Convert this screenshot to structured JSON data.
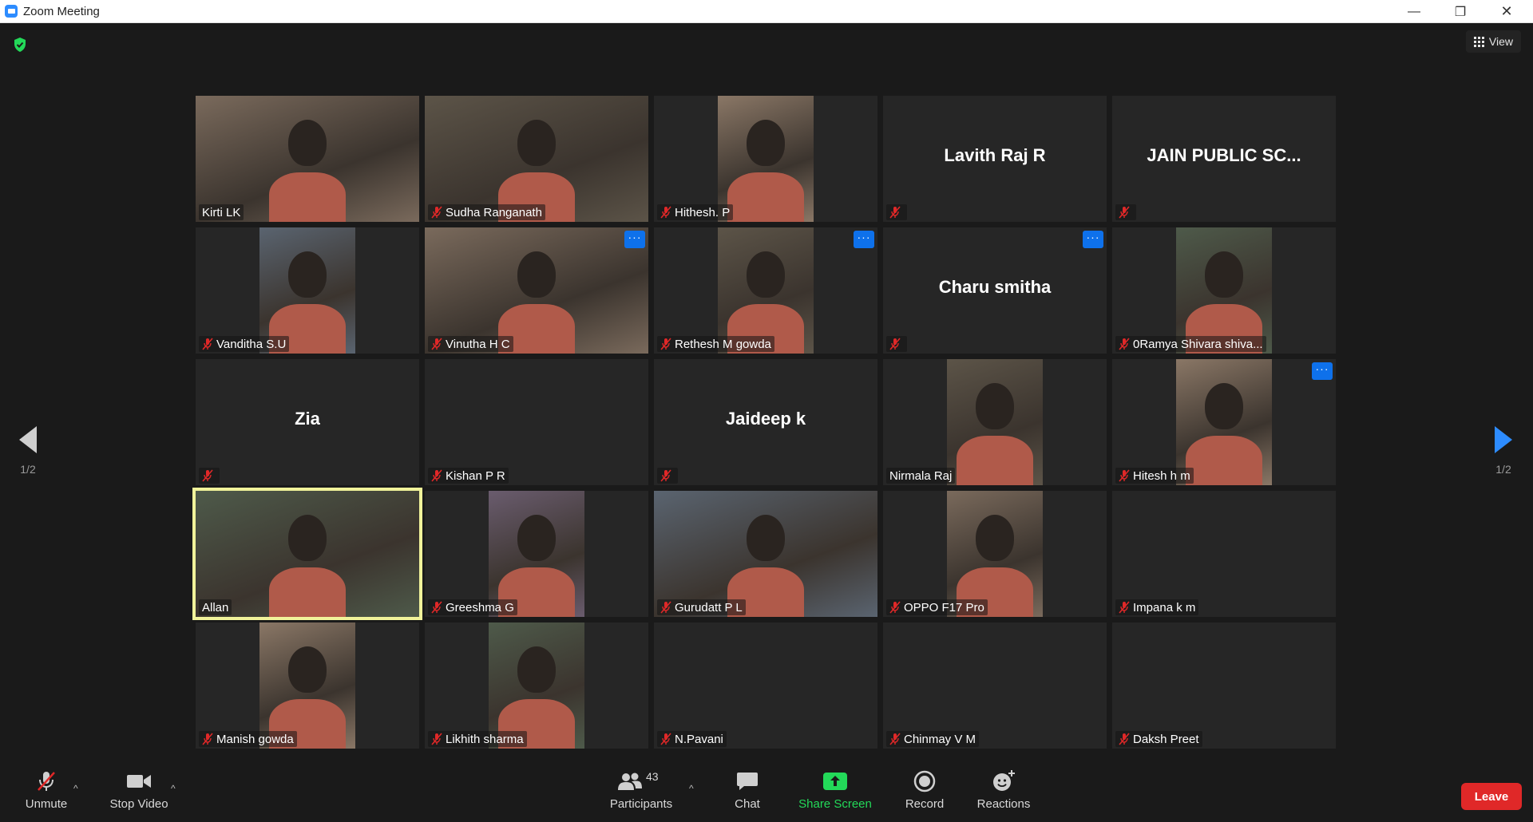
{
  "window": {
    "title": "Zoom Meeting"
  },
  "view": {
    "label": "View"
  },
  "pagination": {
    "left_page": "1/2",
    "right_page": "1/2"
  },
  "participants": [
    {
      "name": "Kirti LK",
      "muted": false,
      "card": "",
      "video": "w",
      "more": false
    },
    {
      "name": "Sudha Ranganath",
      "muted": true,
      "card": "",
      "video": "w",
      "more": false
    },
    {
      "name": "Hithesh. P",
      "muted": true,
      "card": "",
      "video": "n",
      "more": false
    },
    {
      "name": "",
      "muted": true,
      "card": "Lavith Raj R",
      "video": "",
      "more": false
    },
    {
      "name": "",
      "muted": true,
      "card": "JAIN PUBLIC SC...",
      "video": "",
      "more": false
    },
    {
      "name": "Vanditha S.U",
      "muted": true,
      "card": "",
      "video": "n",
      "more": false
    },
    {
      "name": "Vinutha H C",
      "muted": true,
      "card": "",
      "video": "w",
      "more": true
    },
    {
      "name": "Rethesh M gowda",
      "muted": true,
      "card": "",
      "video": "n",
      "more": true
    },
    {
      "name": "",
      "muted": true,
      "card": "Charu smitha",
      "video": "",
      "more": true
    },
    {
      "name": "0Ramya Shivara shiva...",
      "muted": true,
      "card": "",
      "video": "n",
      "more": false
    },
    {
      "name": "",
      "muted": true,
      "card": "Zia",
      "video": "",
      "more": false
    },
    {
      "name": "Kishan P R",
      "muted": true,
      "card": "",
      "video": "",
      "more": false
    },
    {
      "name": "",
      "muted": true,
      "card": "Jaideep k",
      "video": "",
      "more": false
    },
    {
      "name": "Nirmala Raj",
      "muted": false,
      "card": "",
      "video": "n",
      "more": false
    },
    {
      "name": "Hitesh h m",
      "muted": true,
      "card": "",
      "video": "n",
      "more": true
    },
    {
      "name": "Allan",
      "muted": false,
      "card": "",
      "video": "w",
      "more": false,
      "active": true
    },
    {
      "name": "Greeshma G",
      "muted": true,
      "card": "",
      "video": "n",
      "more": false
    },
    {
      "name": "Gurudatt P L",
      "muted": true,
      "card": "",
      "video": "w",
      "more": false
    },
    {
      "name": "OPPO F17 Pro",
      "muted": true,
      "card": "",
      "video": "n",
      "more": false
    },
    {
      "name": "Impana k m",
      "muted": true,
      "card": "",
      "video": "",
      "more": false
    },
    {
      "name": "Manish gowda",
      "muted": true,
      "card": "",
      "video": "n",
      "more": false
    },
    {
      "name": "Likhith sharma",
      "muted": true,
      "card": "",
      "video": "n",
      "more": false
    },
    {
      "name": "N.Pavani",
      "muted": true,
      "card": "",
      "video": "",
      "more": false
    },
    {
      "name": "Chinmay V M",
      "muted": true,
      "card": "",
      "video": "",
      "more": false
    },
    {
      "name": "Daksh Preet",
      "muted": true,
      "card": "",
      "video": "",
      "more": false
    }
  ],
  "toolbar": {
    "unmute": "Unmute",
    "stop_video": "Stop Video",
    "participants": "Participants",
    "participant_count": "43",
    "chat": "Chat",
    "share_screen": "Share Screen",
    "record": "Record",
    "reactions": "Reactions",
    "leave": "Leave"
  },
  "colors": {
    "share_green": "#23d959",
    "leave_red": "#e02828",
    "active_outline": "#f1f39a",
    "more_blue": "#0e71eb",
    "mute_red": "#e02828"
  }
}
